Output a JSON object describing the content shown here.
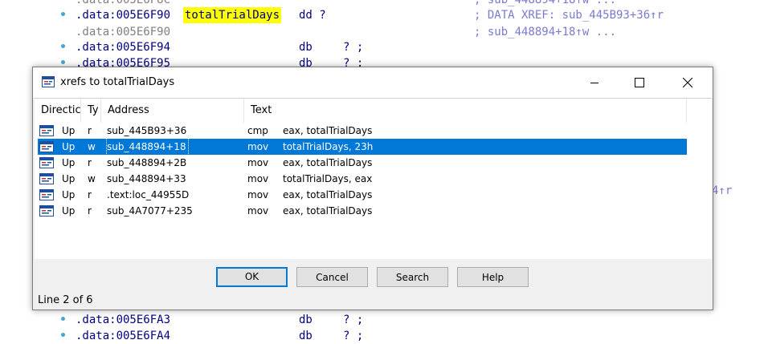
{
  "listing": {
    "top_partial": {
      "addr": ".data:005E6F8C",
      "cmt": "; sub_448894+18↑w ..."
    },
    "line1": {
      "addr": ".data:005E6F90",
      "name": "totalTrialDays",
      "mn": "dd ?",
      "cmt": "; DATA XREF: sub_445B93+36↑r"
    },
    "line2": {
      "addr": ".data:005E6F90",
      "cmt": "; sub_448894+18↑w ..."
    },
    "line3": {
      "addr": ".data:005E6F94",
      "mn": "db",
      "op": "? ;"
    },
    "line4": {
      "addr": ".data:005E6F95",
      "mn": "db",
      "op": "? ;"
    },
    "line5": {
      "addr": ".data:005E6FA3",
      "mn": "db",
      "op": "? ;"
    },
    "line6": {
      "addr": ".data:005E6FA4",
      "mn": "db",
      "op": "? ;"
    },
    "stray_right": "4↑r"
  },
  "dialog": {
    "title": "xrefs to totalTrialDays",
    "columns": [
      "Directic",
      "Ty",
      "Address",
      "Text"
    ],
    "rows": [
      {
        "dir": "Up",
        "type": "r",
        "address": "sub_445B93+36",
        "mnem": "cmp",
        "operands": "eax, totalTrialDays"
      },
      {
        "dir": "Up",
        "type": "w",
        "address": "sub_448894+18",
        "mnem": "mov",
        "operands": "totalTrialDays, 23h"
      },
      {
        "dir": "Up",
        "type": "r",
        "address": "sub_448894+2B",
        "mnem": "mov",
        "operands": "eax, totalTrialDays"
      },
      {
        "dir": "Up",
        "type": "w",
        "address": "sub_448894+33",
        "mnem": "mov",
        "operands": "totalTrialDays, eax"
      },
      {
        "dir": "Up",
        "type": "r",
        "address": ".text:loc_44955D",
        "mnem": "mov",
        "operands": "eax, totalTrialDays"
      },
      {
        "dir": "Up",
        "type": "r",
        "address": "sub_4A7077+235",
        "mnem": "mov",
        "operands": "eax, totalTrialDays"
      }
    ],
    "selected_index": 1,
    "buttons": {
      "ok": "OK",
      "cancel": "Cancel",
      "search": "Search",
      "help": "Help"
    },
    "status": "Line 2 of 6"
  },
  "colors": {
    "selection": "#0078d7",
    "highlight": "#ffff00",
    "comment": "#7a7ad0"
  },
  "icons": [
    "xref-icon",
    "minimize-icon",
    "maximize-icon",
    "close-icon"
  ]
}
